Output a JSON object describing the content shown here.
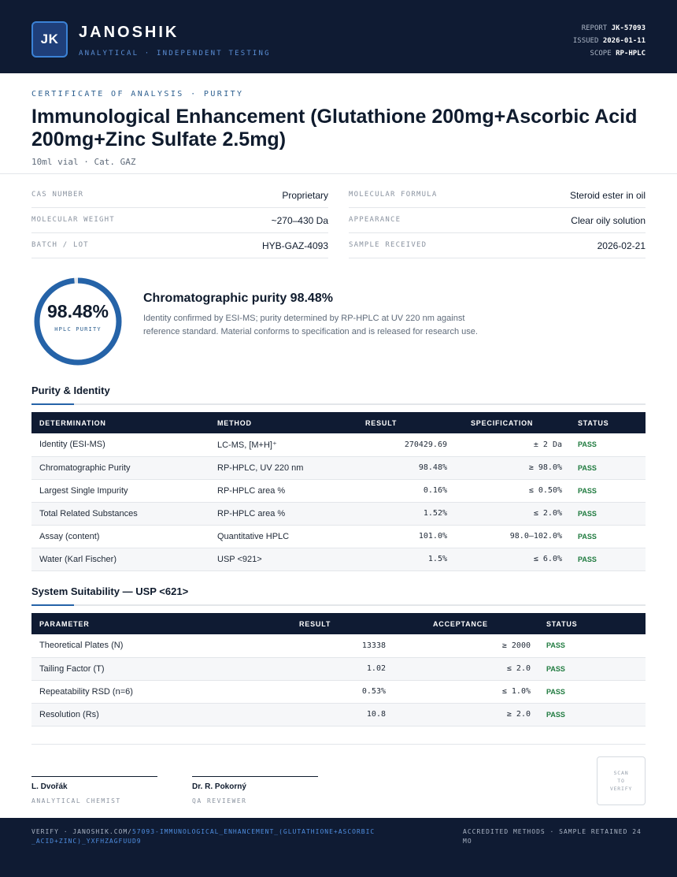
{
  "header": {
    "logo_text": "JK",
    "brand": "JANOSHIK",
    "brand_sub": "ANALYTICAL · INDEPENDENT TESTING",
    "report_label": "REPORT",
    "report_value": "JK-57093",
    "issued_label": "ISSUED",
    "issued_value": "2026-01-11",
    "scope_label": "SCOPE",
    "scope_value": "RP-HPLC"
  },
  "doc": {
    "kicker": "CERTIFICATE OF ANALYSIS · PURITY",
    "title": "Immunological Enhancement (Glutathione 200mg+Ascorbic Acid 200mg+Zinc Sulfate 2.5mg)",
    "subtitle": "10ml vial  ·  Cat. GAZ"
  },
  "properties": [
    {
      "label": "CAS NUMBER",
      "value": "Proprietary"
    },
    {
      "label": "MOLECULAR FORMULA",
      "value": "Steroid ester in oil"
    },
    {
      "label": "MOLECULAR WEIGHT",
      "value": "~270–430 Da"
    },
    {
      "label": "APPEARANCE",
      "value": "Clear oily solution"
    },
    {
      "label": "BATCH / LOT",
      "value": "HYB-GAZ-4093"
    },
    {
      "label": "SAMPLE RECEIVED",
      "value": "2026-02-21"
    }
  ],
  "purity": {
    "value": "98.48%",
    "fraction": 0.9848,
    "ring_label": "HPLC PURITY",
    "headline": "Chromatographic purity 98.48%",
    "description": "Identity confirmed by ESI-MS; purity determined by RP-HPLC at UV 220 nm against reference standard. Material conforms to specification and is released for research use."
  },
  "purity_table": {
    "title": "Purity & Identity",
    "headers": [
      "DETERMINATION",
      "METHOD",
      "RESULT",
      "SPECIFICATION",
      "STATUS"
    ],
    "rows": [
      {
        "determination": "Identity (ESI-MS)",
        "method": "LC-MS, [M+H]⁺",
        "result": "270429.69",
        "spec": "± 2 Da",
        "status": "PASS"
      },
      {
        "determination": "Chromatographic Purity",
        "method": "RP-HPLC, UV 220 nm",
        "result": "98.48%",
        "spec": "≥ 98.0%",
        "status": "PASS"
      },
      {
        "determination": "Largest Single Impurity",
        "method": "RP-HPLC area %",
        "result": "0.16%",
        "spec": "≤ 0.50%",
        "status": "PASS"
      },
      {
        "determination": "Total Related Substances",
        "method": "RP-HPLC area %",
        "result": "1.52%",
        "spec": "≤ 2.0%",
        "status": "PASS"
      },
      {
        "determination": "Assay (content)",
        "method": "Quantitative HPLC",
        "result": "101.0%",
        "spec": "98.0–102.0%",
        "status": "PASS"
      },
      {
        "determination": "Water (Karl Fischer)",
        "method": "USP <921>",
        "result": "1.5%",
        "spec": "≤ 6.0%",
        "status": "PASS"
      }
    ]
  },
  "suitability_table": {
    "title": "System Suitability — USP <621>",
    "headers": [
      "PARAMETER",
      "RESULT",
      "ACCEPTANCE",
      "STATUS"
    ],
    "rows": [
      {
        "parameter": "Theoretical Plates (N)",
        "result": "13338",
        "acceptance": "≥ 2000",
        "status": "PASS"
      },
      {
        "parameter": "Tailing Factor (T)",
        "result": "1.02",
        "acceptance": "≤ 2.0",
        "status": "PASS"
      },
      {
        "parameter": "Repeatability RSD (n=6)",
        "result": "0.53%",
        "acceptance": "≤ 1.0%",
        "status": "PASS"
      },
      {
        "parameter": "Resolution (Rs)",
        "result": "10.8",
        "acceptance": "≥ 2.0",
        "status": "PASS"
      }
    ]
  },
  "signatures": [
    {
      "name": "L. Dvořák",
      "role": "ANALYTICAL CHEMIST"
    },
    {
      "name": "Dr. R. Pokorný",
      "role": "QA REVIEWER"
    }
  ],
  "qr": {
    "line1": "SCAN",
    "line2": "TO",
    "line3": "VERIFY"
  },
  "footer": {
    "verify_prefix": "VERIFY · JANOSHIK.COM/",
    "verify_link": "57093-IMMUNOLOGICAL_ENHANCEMENT_(GLUTATHIONE+ASCORBIC_ACID+ZINC)_YXFHZAGFUUD9",
    "right_text": "ACCREDITED METHODS · SAMPLE RETAINED 24 MO"
  },
  "colors": {
    "navy": "#0f1b33",
    "accent": "#2563a8",
    "pass_green": "#1e7a3e"
  }
}
